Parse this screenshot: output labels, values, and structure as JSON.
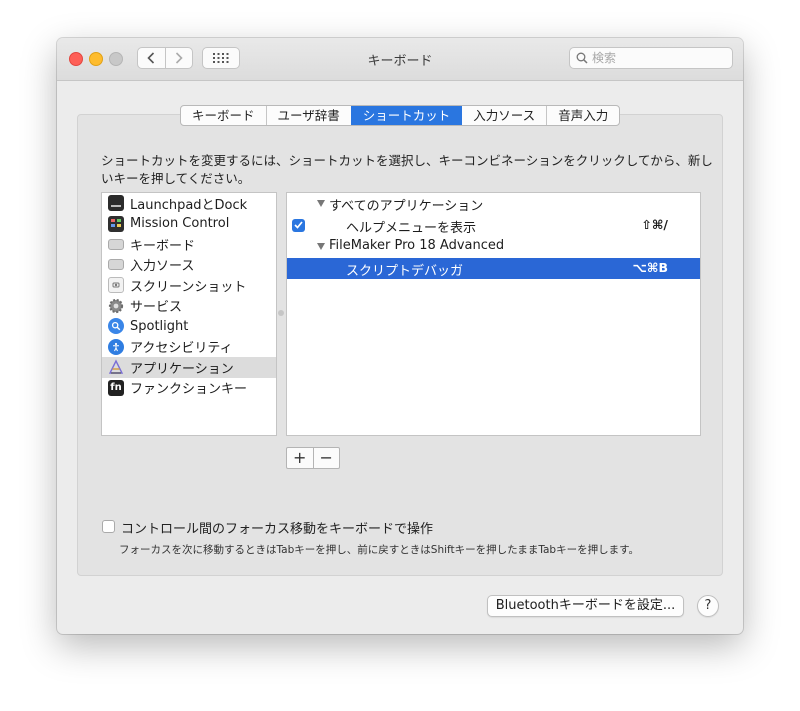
{
  "window": {
    "title": "キーボード",
    "search_placeholder": "検索"
  },
  "tabs": [
    {
      "label": "キーボード",
      "active": false
    },
    {
      "label": "ユーザ辞書",
      "active": false
    },
    {
      "label": "ショートカット",
      "active": true
    },
    {
      "label": "入力ソース",
      "active": false
    },
    {
      "label": "音声入力",
      "active": false
    }
  ],
  "description": "ショートカットを変更するには、ショートカットを選択し、キーコンビネーションをクリックしてから、新しいキーを押してください。",
  "categories": [
    {
      "label": "LaunchpadとDock",
      "icon": "launchpad-dock-icon"
    },
    {
      "label": "Mission Control",
      "icon": "mission-control-icon"
    },
    {
      "label": "キーボード",
      "icon": "keyboard-icon"
    },
    {
      "label": "入力ソース",
      "icon": "input-source-icon"
    },
    {
      "label": "スクリーンショット",
      "icon": "screenshot-icon"
    },
    {
      "label": "サービス",
      "icon": "gear-icon"
    },
    {
      "label": "Spotlight",
      "icon": "spotlight-icon"
    },
    {
      "label": "アクセシビリティ",
      "icon": "accessibility-icon"
    },
    {
      "label": "アプリケーション",
      "icon": "applications-icon",
      "selected": true
    },
    {
      "label": "ファンクションキー",
      "icon": "fn-key-icon"
    }
  ],
  "shortcuts": [
    {
      "type": "group",
      "label": "すべてのアプリケーション"
    },
    {
      "type": "item",
      "label": "ヘルプメニューを表示",
      "key": "⇧⌘/",
      "checked": true
    },
    {
      "type": "group",
      "label": "FileMaker Pro 18 Advanced"
    },
    {
      "type": "item",
      "label": "スクリプトデバッガ",
      "key": "⌥⌘B",
      "selected": true
    }
  ],
  "add_button": "+",
  "remove_button": "−",
  "keyboard_nav": {
    "label": "コントロール間のフォーカス移動をキーボードで操作",
    "checked": false,
    "note": "フォーカスを次に移動するときはTabキーを押し、前に戻すときはShiftキーを押したままTabキーを押します。"
  },
  "bluetooth_button": "Bluetoothキーボードを設定...",
  "help_button": "?",
  "colors": {
    "accent": "#2a76e0",
    "selection": "#2a67d6",
    "close": "#fe5f57",
    "minimize": "#febc2e"
  }
}
